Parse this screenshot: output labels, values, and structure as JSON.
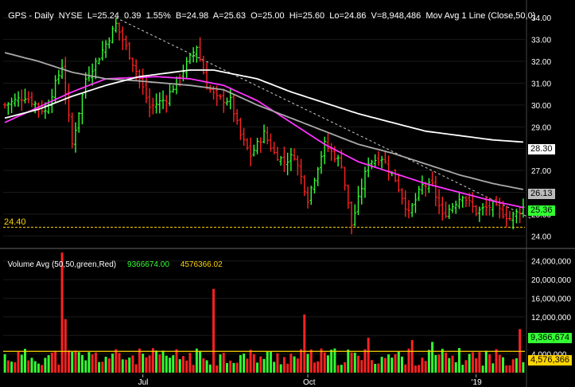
{
  "header": {
    "symbol": "GPS",
    "period": "Daily",
    "exchange": "NYSE",
    "last": "L=25.24",
    "change": "0.39",
    "change_pct": "1.55%",
    "bid": "B=24.98",
    "ask": "A=25.63",
    "open": "O=25.00",
    "high": "Hi=25.60",
    "low": "Lo=24.86",
    "volume": "V=8,948,486",
    "study": "Mov Avg 1 Line (Close,50,0)"
  },
  "volume_header": {
    "label": "Volume Avg (50,50,green,Red)",
    "value1": "9366674.00",
    "value2": "4576366.02"
  },
  "price_tags": {
    "sma200": "28.30",
    "sma100": "26.13",
    "last": "25.36",
    "support": "24.40"
  },
  "volume_tags": {
    "vol": "9,366,674",
    "avg": "4,576,366"
  },
  "colors": {
    "up": "#33ff33",
    "down": "#ff2222",
    "ma50": "#ff33ff",
    "ma100": "#aaaaaa",
    "ma200": "#ffffff",
    "volavg": "#ffd400",
    "bg": "#000000"
  },
  "chart_data": [
    {
      "type": "line",
      "title": "GPS - Daily NYSE",
      "x_ticks": [
        "Jul",
        "Oct",
        "'19"
      ],
      "y_ticks": [
        "24.00",
        "25.00",
        "26.00",
        "27.00",
        "28.00",
        "29.00",
        "30.00",
        "31.00",
        "32.00",
        "33.00",
        "34.00"
      ],
      "ylim": [
        23.5,
        34.3
      ],
      "n_bars": 155,
      "price_anchors": [
        [
          0,
          30.0
        ],
        [
          6,
          30.4
        ],
        [
          12,
          29.7
        ],
        [
          17,
          31.8
        ],
        [
          20,
          28.2
        ],
        [
          24,
          31.2
        ],
        [
          28,
          32.2
        ],
        [
          33,
          33.7
        ],
        [
          37,
          32.3
        ],
        [
          40,
          31.2
        ],
        [
          43,
          29.9
        ],
        [
          48,
          30.3
        ],
        [
          53,
          31.6
        ],
        [
          57,
          32.7
        ],
        [
          60,
          30.9
        ],
        [
          63,
          30.3
        ],
        [
          67,
          30.2
        ],
        [
          70,
          28.6
        ],
        [
          73,
          27.7
        ],
        [
          77,
          28.7
        ],
        [
          80,
          27.8
        ],
        [
          83,
          27.4
        ],
        [
          86,
          27.7
        ],
        [
          90,
          25.7
        ],
        [
          95,
          28.2
        ],
        [
          100,
          27.3
        ],
        [
          103,
          24.5
        ],
        [
          108,
          27.4
        ],
        [
          112,
          27.6
        ],
        [
          116,
          26.6
        ],
        [
          120,
          25.0
        ],
        [
          124,
          26.3
        ],
        [
          127,
          26.3
        ],
        [
          130,
          24.9
        ],
        [
          133,
          25.4
        ],
        [
          136,
          25.9
        ],
        [
          140,
          25.1
        ],
        [
          145,
          25.4
        ],
        [
          150,
          24.8
        ],
        [
          154,
          25.3
        ]
      ],
      "series": [
        {
          "name": "Mov Avg 50",
          "values": [
            [
              0,
              29.2
            ],
            [
              10,
              29.9
            ],
            [
              20,
              30.6
            ],
            [
              30,
              31.2
            ],
            [
              45,
              31.3
            ],
            [
              55,
              31.2
            ],
            [
              65,
              30.9
            ],
            [
              75,
              30.2
            ],
            [
              85,
              29.2
            ],
            [
              95,
              28.2
            ],
            [
              105,
              27.4
            ],
            [
              115,
              26.9
            ],
            [
              125,
              26.4
            ],
            [
              135,
              26.0
            ],
            [
              145,
              25.6
            ],
            [
              154,
              25.3
            ]
          ]
        },
        {
          "name": "Mov Avg 100",
          "values": [
            [
              0,
              32.4
            ],
            [
              10,
              32.0
            ],
            [
              20,
              31.5
            ],
            [
              30,
              31.2
            ],
            [
              40,
              31.1
            ],
            [
              55,
              30.9
            ],
            [
              65,
              30.7
            ],
            [
              75,
              30.0
            ],
            [
              85,
              29.4
            ],
            [
              95,
              28.8
            ],
            [
              105,
              28.2
            ],
            [
              115,
              27.8
            ],
            [
              125,
              27.3
            ],
            [
              135,
              26.8
            ],
            [
              145,
              26.4
            ],
            [
              154,
              26.13
            ]
          ]
        },
        {
          "name": "Mov Avg 200",
          "values": [
            [
              0,
              29.4
            ],
            [
              10,
              29.8
            ],
            [
              20,
              30.4
            ],
            [
              30,
              30.9
            ],
            [
              40,
              31.3
            ],
            [
              55,
              31.6
            ],
            [
              62,
              31.6
            ],
            [
              75,
              31.2
            ],
            [
              85,
              30.6
            ],
            [
              95,
              30.1
            ],
            [
              105,
              29.6
            ],
            [
              115,
              29.2
            ],
            [
              125,
              28.8
            ],
            [
              135,
              28.6
            ],
            [
              145,
              28.4
            ],
            [
              154,
              28.3
            ]
          ]
        }
      ],
      "support_line": 24.4,
      "trendline": [
        [
          33,
          34.0
        ],
        [
          154,
          24.8
        ]
      ]
    },
    {
      "type": "bar",
      "title": "Volume Avg (50,50,green,Red)",
      "y_ticks": [
        "4,000,000",
        "8,000,000",
        "12,000,000",
        "16,000,000",
        "20,000,000",
        "24,000,000"
      ],
      "ylim": [
        0,
        26000000
      ],
      "spikes": [
        {
          "bar": 17,
          "value": 25800000
        },
        {
          "bar": 18,
          "value": 11500000
        },
        {
          "bar": 62,
          "value": 18000000
        },
        {
          "bar": 89,
          "value": 12500000
        },
        {
          "bar": 108,
          "value": 7500000
        },
        {
          "bar": 121,
          "value": 7000000
        },
        {
          "bar": 127,
          "value": 6600000
        },
        {
          "bar": 153,
          "value": 9366674
        }
      ],
      "average_value": 4576366
    }
  ]
}
